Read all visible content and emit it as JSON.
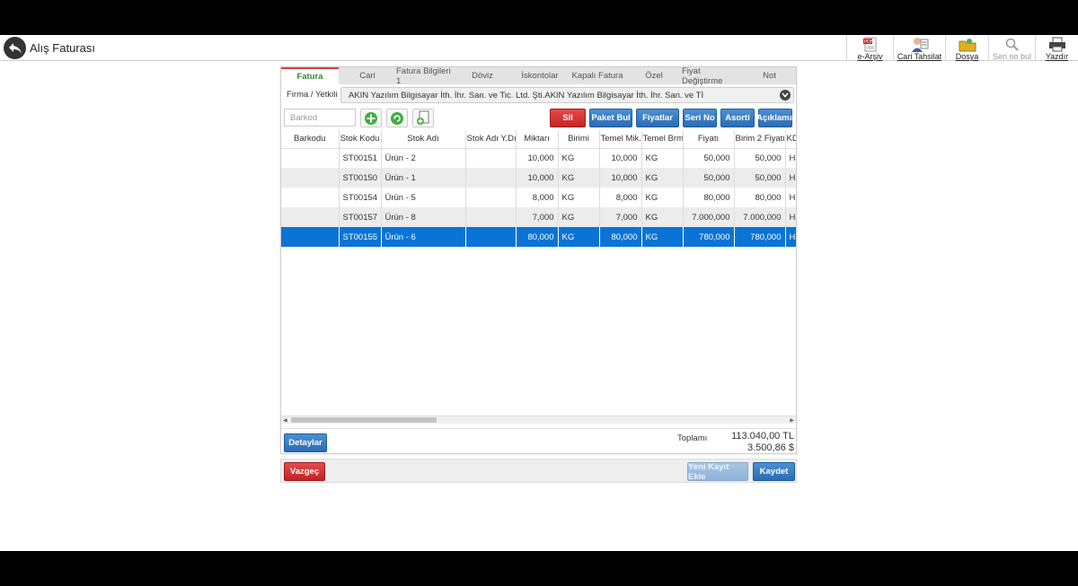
{
  "header": {
    "title": "Alış Faturası",
    "toolbar": [
      {
        "label": "e-Arşiv",
        "icon": "pdf-icon"
      },
      {
        "label": "Cari Tahsilat",
        "icon": "person-cash-icon"
      },
      {
        "label": "Dosya",
        "icon": "folder-icon"
      },
      {
        "label": "Seri no bul",
        "icon": "search-icon"
      },
      {
        "label": "Yazdır",
        "icon": "printer-icon"
      }
    ]
  },
  "tabs": [
    "Fatura",
    "Cari",
    "Fatura Bilgileri 1",
    "Döviz",
    "İskontolar",
    "Kapalı Fatura",
    "Özel",
    "Fiyat Değiştirme",
    "Not"
  ],
  "firma": {
    "label": "Firma / Yetkili",
    "value": "AKIN Yazılım Bilgisayar İth. İhr. San. ve Tic. Ltd. Şti.AKIN Yazılım Bilgisayar İth. İhr. San. ve Tİ"
  },
  "actions": {
    "barkod_placeholder": "Barkod",
    "sil": "Sil",
    "paket_bul": "Paket Bul",
    "fiyatlar": "Fiyatlar",
    "seri_no": "Seri No",
    "asorti": "Asorti",
    "aciklama": "Açıklama"
  },
  "grid": {
    "columns": [
      "Barkodu",
      "Stok Kodu",
      "Stok Adı",
      "Stok Adı Y.Dı",
      "Miktarı",
      "Birimi",
      "Temel Mik.",
      "Temel Brm",
      "Fiyatı",
      "Birim 2 Fiyatı",
      "KD"
    ],
    "rows": [
      {
        "barkod": "",
        "kod": "ST00151",
        "ad": "Ürün - 2",
        "ady": "",
        "miktar": "10,000",
        "birim": "KG",
        "temel": "10,000",
        "tbrm": "KG",
        "fiyat": "50,000",
        "fiyat2": "50,000",
        "kd": "Ha"
      },
      {
        "barkod": "",
        "kod": "ST00150",
        "ad": "Ürün - 1",
        "ady": "",
        "miktar": "10,000",
        "birim": "KG",
        "temel": "10,000",
        "tbrm": "KG",
        "fiyat": "50,000",
        "fiyat2": "50,000",
        "kd": "Ha"
      },
      {
        "barkod": "",
        "kod": "ST00154",
        "ad": "Ürün - 5",
        "ady": "",
        "miktar": "8,000",
        "birim": "KG",
        "temel": "8,000",
        "tbrm": "KG",
        "fiyat": "80,000",
        "fiyat2": "80,000",
        "kd": "Ha"
      },
      {
        "barkod": "",
        "kod": "ST00157",
        "ad": "Ürün - 8",
        "ady": "",
        "miktar": "7,000",
        "birim": "KG",
        "temel": "7,000",
        "tbrm": "KG",
        "fiyat": "7.000,000",
        "fiyat2": "7.000,000",
        "kd": "Ha"
      },
      {
        "barkod": "",
        "kod": "ST00155",
        "ad": "Ürün - 6",
        "ady": "",
        "miktar": "80,000",
        "birim": "KG",
        "temel": "80,000",
        "tbrm": "KG",
        "fiyat": "780,000",
        "fiyat2": "780,000",
        "kd": "Ha"
      }
    ],
    "selected_row": 4
  },
  "summary": {
    "detaylar": "Detaylar",
    "toplam_label": "Toplamı",
    "toplam_tl": "113.040,00 TL",
    "toplam_usd": "3.500,86 $"
  },
  "footer": {
    "vazgec": "Vazgeç",
    "yeni_kayit": "Yeni Kayıt Ekle",
    "kaydet": "Kaydet"
  }
}
